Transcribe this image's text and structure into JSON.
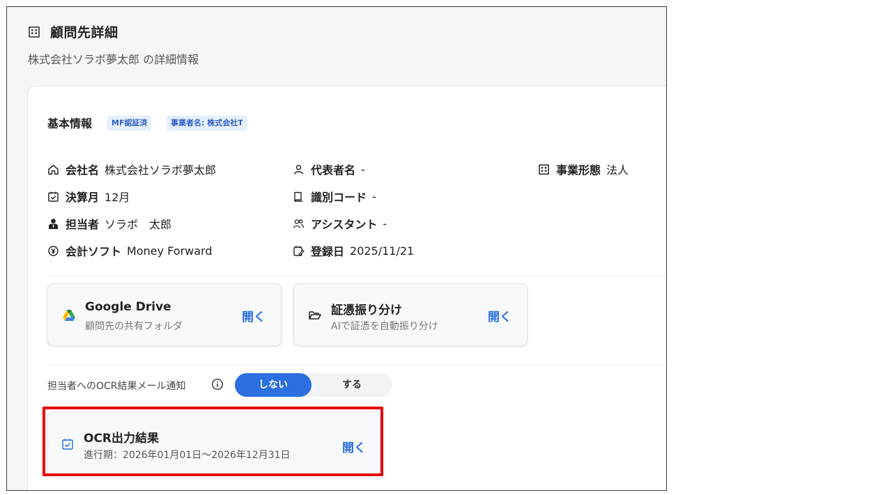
{
  "header": {
    "title": "顧問先詳細",
    "subtitle": "株式会社ソラボ夢太郎 の詳細情報"
  },
  "basic_info": {
    "title": "基本情報",
    "badges": [
      "MF認証済",
      "事業者名: 株式会社T"
    ],
    "fields": [
      {
        "icon": "home-icon",
        "label": "会社名",
        "value": "株式会社ソラボ夢太郎"
      },
      {
        "icon": "user-icon",
        "label": "代表者名",
        "value": "-"
      },
      {
        "icon": "building-icon",
        "label": "事業形態",
        "value": "法人"
      },
      {
        "icon": "calendar-check-icon",
        "label": "決算月",
        "value": "12月"
      },
      {
        "icon": "code-icon",
        "label": "識別コード",
        "value": "-"
      },
      {
        "icon": "person-tie-icon",
        "label": "担当者",
        "value": "ソラボ　太郎"
      },
      {
        "icon": "users-icon",
        "label": "アシスタント",
        "value": "-"
      },
      {
        "icon": "currency-icon",
        "label": "会計ソフト",
        "value": "Money Forward"
      },
      {
        "icon": "calendar-edit-icon",
        "label": "登録日",
        "value": "2025/11/21"
      }
    ]
  },
  "link_cards": [
    {
      "title": "Google Drive",
      "subtitle": "顧問先の共有フォルダ",
      "action": "開く"
    },
    {
      "title": "証憑振り分け",
      "subtitle": "AIで証憑を自動振り分け",
      "action": "開く"
    }
  ],
  "notification": {
    "label": "担当者へのOCR結果メール通知",
    "options": [
      "しない",
      "する"
    ],
    "selected": "しない"
  },
  "ocr_card": {
    "title": "OCR出力結果",
    "subtitle": "進行期：2026年01月01日〜2026年12月31日",
    "action": "開く"
  },
  "colors": {
    "accent": "#2b6fe0",
    "highlight": "#e8000b",
    "badge_bg": "#e6effc"
  }
}
